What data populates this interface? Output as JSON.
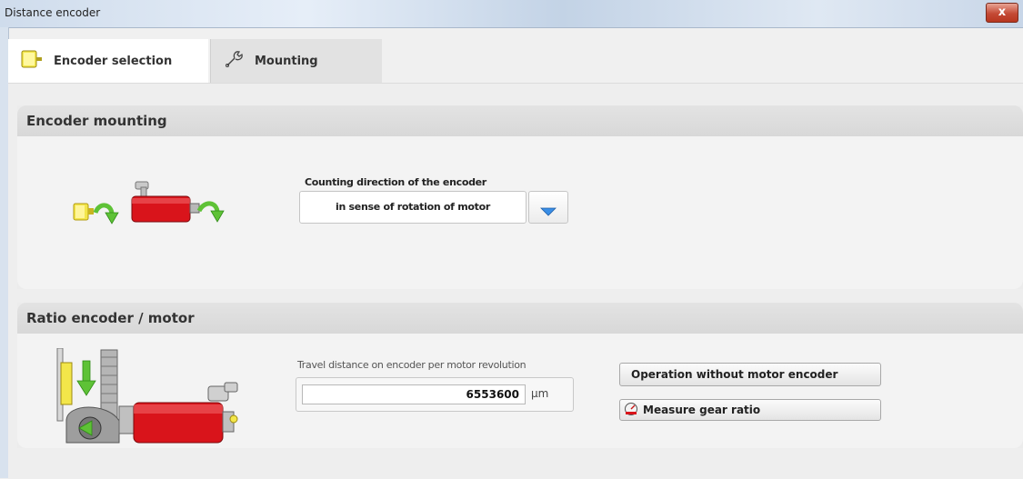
{
  "window": {
    "title": "Distance encoder",
    "close_glyph": "x"
  },
  "tabs": [
    {
      "label": "Encoder selection",
      "icon": "encoder-icon",
      "active": true
    },
    {
      "label": "Mounting",
      "icon": "wrench-icon",
      "active": false
    }
  ],
  "encoder_mounting": {
    "header": "Encoder mounting",
    "direction_label": "Counting direction of the encoder",
    "direction_value": "in sense of rotation of motor",
    "illustration": "encoder-motor-rotation-illustration"
  },
  "ratio": {
    "header": "Ratio encoder / motor",
    "travel_label": "Travel distance on encoder per motor revolution",
    "travel_value": "6553600",
    "travel_unit": "µm",
    "operation_button": "Operation without motor encoder",
    "measure_button": "Measure gear ratio",
    "illustration": "gear-belt-motor-illustration"
  },
  "colors": {
    "accent_blue": "#3a8ee6",
    "motor_red": "#d9141b",
    "encoder_yellow": "#f3e64a",
    "arrow_green": "#5ec236"
  }
}
